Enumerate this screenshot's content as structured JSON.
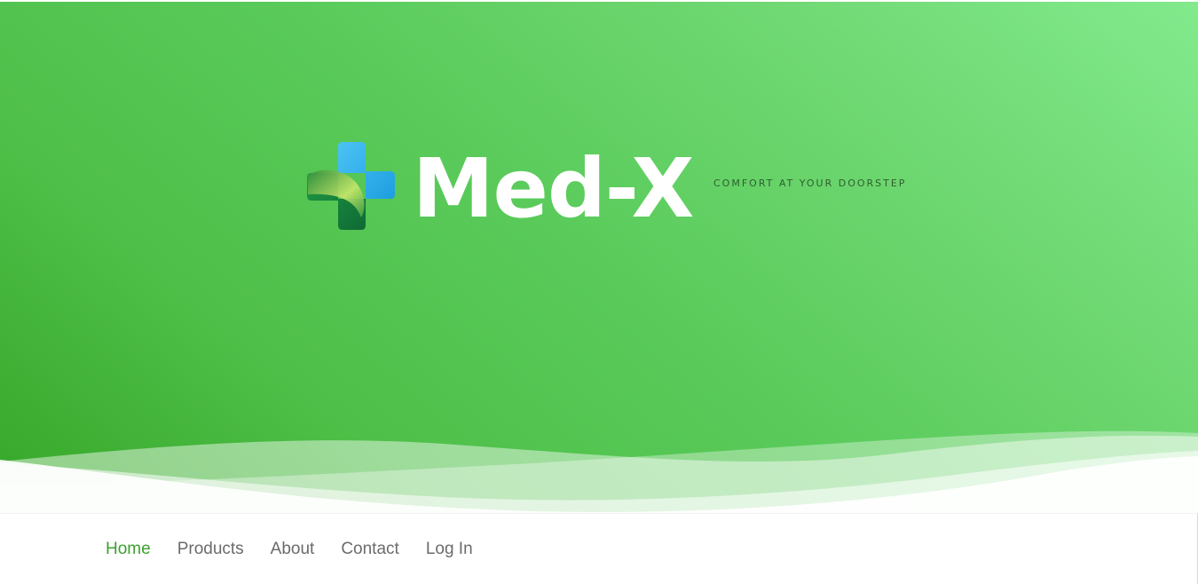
{
  "brand": {
    "name": "Med-X",
    "tagline": "COMFORT AT YOUR DOORSTEP",
    "logo_icon": "medical-cross-leaf-icon"
  },
  "colors": {
    "hero_gradient_start": "#82ea8c",
    "hero_gradient_end": "#36a628",
    "nav_active": "#3ca12f",
    "nav_text": "#6b6b6b",
    "logo_cross_blue": "#2fb0e8",
    "logo_cross_green": "#147a3c"
  },
  "nav": {
    "items": [
      {
        "label": "Home",
        "active": true
      },
      {
        "label": "Products",
        "active": false
      },
      {
        "label": "About",
        "active": false
      },
      {
        "label": "Contact",
        "active": false
      },
      {
        "label": "Log In",
        "active": false
      }
    ]
  }
}
